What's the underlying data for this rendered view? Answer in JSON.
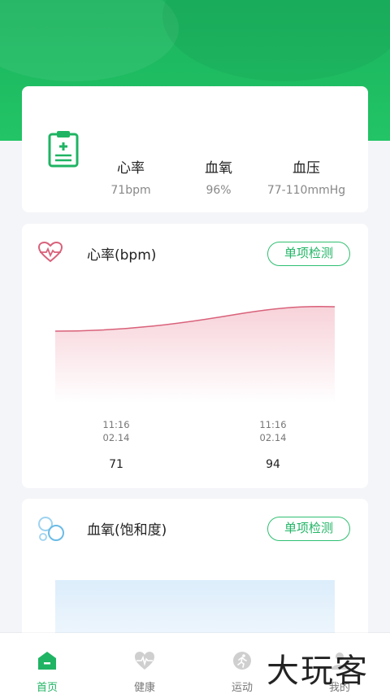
{
  "summary": {
    "metrics": [
      {
        "label": "心率",
        "value": "71bpm"
      },
      {
        "label": "血氧",
        "value": "96%"
      },
      {
        "label": "血压",
        "value": "77-110mmHg"
      }
    ]
  },
  "heart_rate": {
    "title": "心率(bpm)",
    "button": "单项检测",
    "points": [
      {
        "time": "11:16",
        "date": "02.14",
        "value": "71"
      },
      {
        "time": "11:16",
        "date": "02.14",
        "value": "94"
      }
    ]
  },
  "oxygen": {
    "title": "血氧(饱和度)",
    "button": "单项检测"
  },
  "tabs": [
    {
      "label": "首页",
      "icon": "home-icon",
      "active": true
    },
    {
      "label": "健康",
      "icon": "heart-pulse-icon",
      "active": false
    },
    {
      "label": "运动",
      "icon": "running-icon",
      "active": false
    },
    {
      "label": "我的",
      "icon": "user-icon",
      "active": false
    }
  ],
  "watermark": "大玩客",
  "colors": {
    "accent": "#1fb463",
    "heart": "#d9617a",
    "oxygen": "#6bbbe6"
  }
}
